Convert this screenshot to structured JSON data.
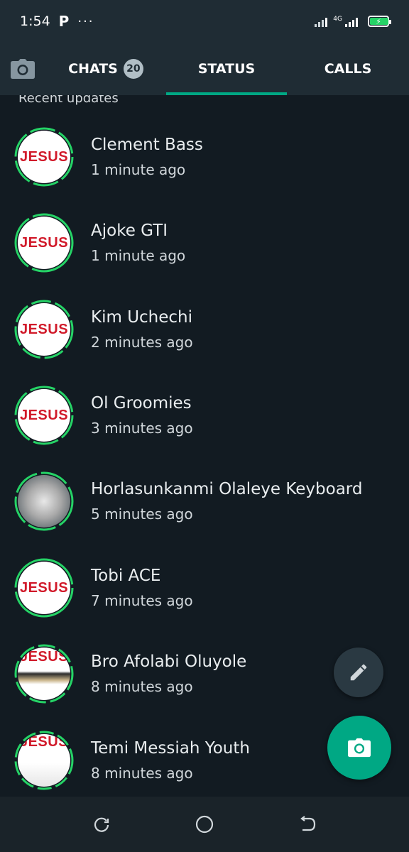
{
  "status_bar": {
    "time": "1:54",
    "app_indicator": "P",
    "more": "···",
    "network": "4G"
  },
  "tabs": {
    "camera_icon": "camera-icon",
    "chats_label": "CHATS",
    "chats_badge": "20",
    "status_label": "STATUS",
    "calls_label": "CALLS"
  },
  "section_title": "Recent updates",
  "statuses": [
    {
      "name": "Clement Bass",
      "time": "1 minute ago",
      "avatar_text": "JESUS"
    },
    {
      "name": "Ajoke GTI",
      "time": "1 minute ago",
      "avatar_text": "JESUS"
    },
    {
      "name": "Kim Uchechi",
      "time": "2 minutes ago",
      "avatar_text": "JESUS"
    },
    {
      "name": "Ol Groomies",
      "time": "3 minutes ago",
      "avatar_text": "JESUS"
    },
    {
      "name": "Horlasunkanmi Olaleye Keyboard",
      "time": "5 minutes ago",
      "avatar_text": ""
    },
    {
      "name": "Tobi ACE",
      "time": "7 minutes ago",
      "avatar_text": "JESUS"
    },
    {
      "name": "Bro Afolabi Oluyole",
      "time": "8 minutes ago",
      "avatar_text": "JESUS"
    },
    {
      "name": "Temi Messiah Youth",
      "time": "8 minutes ago",
      "avatar_text": "JESUS"
    }
  ],
  "fab": {
    "edit_icon": "pencil-icon",
    "camera_icon": "camera-icon"
  },
  "nav": {
    "recents_icon": "recents-icon",
    "home_icon": "home-icon",
    "back_icon": "back-icon"
  },
  "colors": {
    "background": "#121b22",
    "header": "#1f2c34",
    "accent": "#00a884",
    "ring": "#25d366",
    "avatar_text": "#d11a2a"
  }
}
